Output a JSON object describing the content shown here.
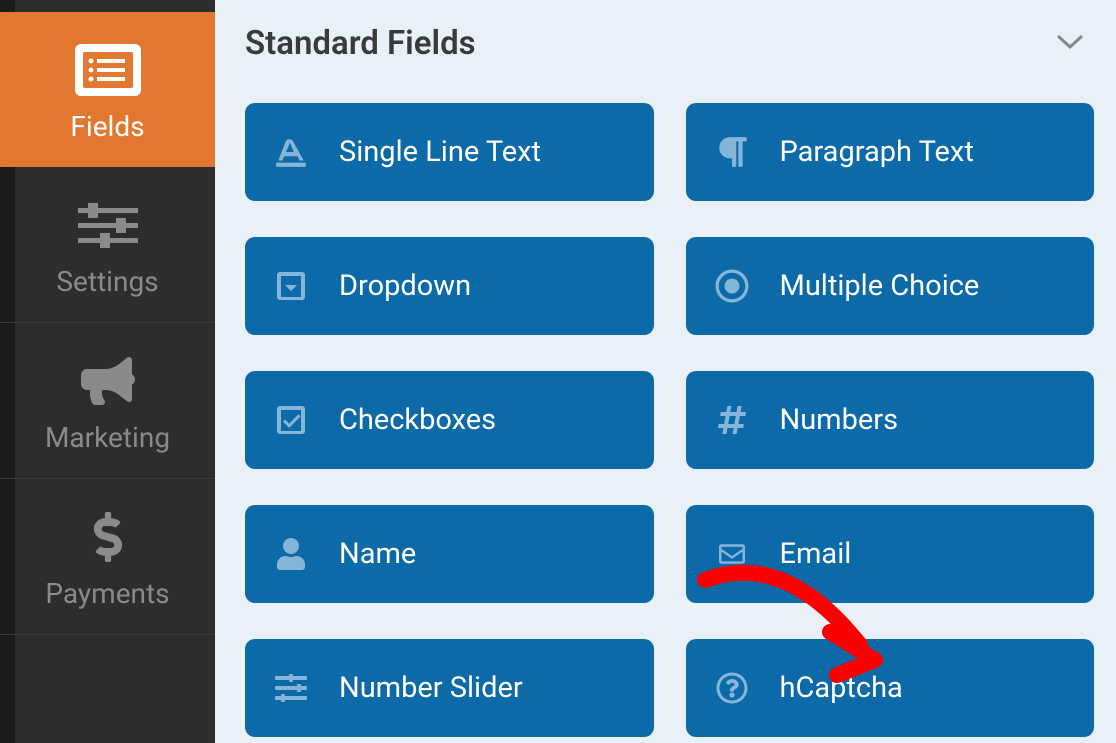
{
  "sidebar": {
    "items": [
      {
        "label": "Fields",
        "active": true
      },
      {
        "label": "Settings",
        "active": false
      },
      {
        "label": "Marketing",
        "active": false
      },
      {
        "label": "Payments",
        "active": false
      }
    ]
  },
  "section": {
    "title": "Standard Fields"
  },
  "fields": [
    {
      "label": "Single Line Text",
      "icon": "text-width"
    },
    {
      "label": "Paragraph Text",
      "icon": "paragraph"
    },
    {
      "label": "Dropdown",
      "icon": "caret-down-square"
    },
    {
      "label": "Multiple Choice",
      "icon": "radio-circle"
    },
    {
      "label": "Checkboxes",
      "icon": "check-square"
    },
    {
      "label": "Numbers",
      "icon": "hash"
    },
    {
      "label": "Name",
      "icon": "user"
    },
    {
      "label": "Email",
      "icon": "envelope"
    },
    {
      "label": "Number Slider",
      "icon": "sliders"
    },
    {
      "label": "hCaptcha",
      "icon": "question-circle"
    }
  ],
  "annotation": {
    "arrow": "red-arrow"
  }
}
